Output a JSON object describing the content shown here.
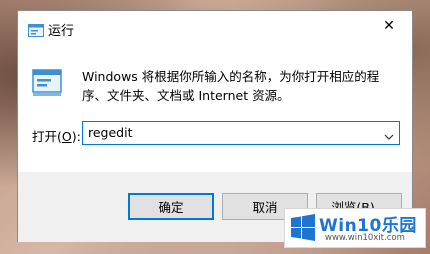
{
  "window": {
    "title": "运行",
    "close_glyph": "✕"
  },
  "description": "Windows 将根据你所输入的名称，为你打开相应的程序、文件夹、文档或 Internet 资源。",
  "open": {
    "label_prefix": "打开(",
    "label_accel": "O",
    "label_suffix": "):",
    "value": "regedit"
  },
  "buttons": {
    "ok": "确定",
    "cancel": "取消",
    "browse": "浏览(B)..."
  },
  "watermark": {
    "title": "Win10乐园",
    "url": "www.win10xit.com"
  },
  "colors": {
    "accent": "#0078d7",
    "footer_bg": "#f0f0f0",
    "button_bg": "#e1e1e1",
    "watermark_blue": "#1d75d1"
  },
  "icons": {
    "title": "run-app-icon",
    "dialog": "run-app-icon",
    "dropdown": "chevron-down-icon",
    "close": "close-icon"
  }
}
